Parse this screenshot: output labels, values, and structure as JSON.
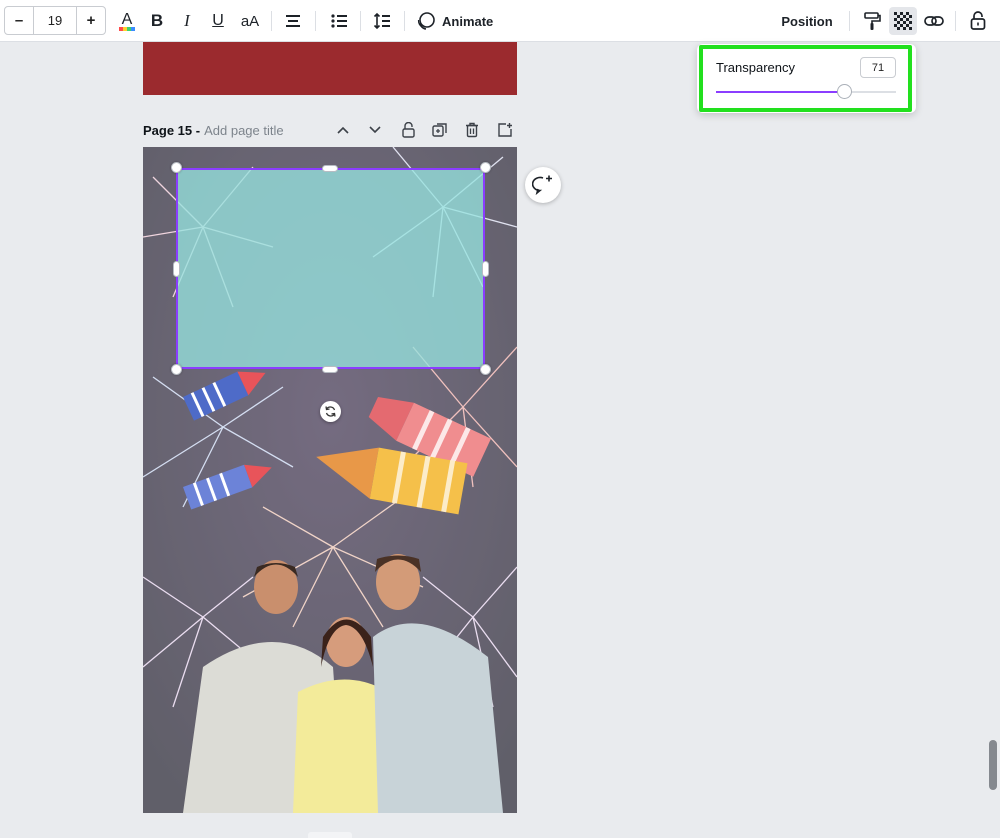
{
  "toolbar": {
    "font_size_decrease": "–",
    "font_size_value": "19",
    "font_size_increase": "+",
    "bold_label": "B",
    "italic_label": "I",
    "underline_label": "U",
    "case_label": "aA",
    "animate_label": "Animate",
    "position_label": "Position",
    "text_color_underline": "rainbow",
    "icons": [
      "text-color-icon",
      "align-center-icon",
      "bullet-list-icon",
      "line-spacing-icon",
      "animate-icon",
      "paint-format-icon",
      "transparency-icon",
      "link-icon",
      "lock-icon"
    ]
  },
  "page_header": {
    "page_number": "Page 15 -",
    "title_placeholder": "Add page title",
    "icons": [
      "chevron-up-icon",
      "chevron-down-icon",
      "lock-icon",
      "duplicate-icon",
      "trash-icon",
      "add-page-icon"
    ]
  },
  "transparency_popover": {
    "label": "Transparency",
    "value": "71",
    "slider_fraction": 0.71,
    "highlight_color": "#22e01e"
  },
  "colors": {
    "accent": "#8b3dff",
    "red_page": "#9b2a2e",
    "selection_fill": "#96e1de"
  }
}
